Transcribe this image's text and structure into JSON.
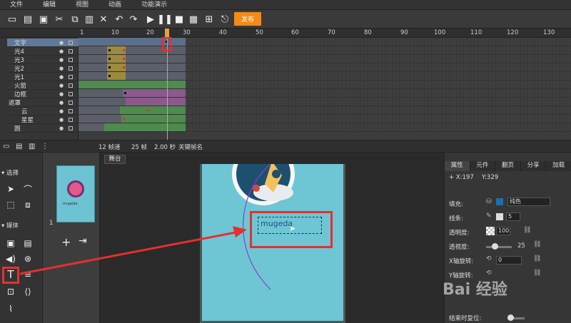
{
  "menu": [
    "文件",
    "编辑",
    "视图",
    "动画",
    "功能演示"
  ],
  "toolbar": {
    "publish_label": "发布"
  },
  "timeline": {
    "ruler": [
      "1",
      "10",
      "20",
      "30",
      "40",
      "50",
      "60",
      "70",
      "80",
      "90",
      "100",
      "110",
      "120",
      "130"
    ],
    "layers": [
      {
        "name": "文字"
      },
      {
        "name": "光4"
      },
      {
        "name": "光3"
      },
      {
        "name": "光2"
      },
      {
        "name": "光1"
      },
      {
        "name": "火箭"
      },
      {
        "name": "边框"
      },
      {
        "name": "遮罩"
      },
      {
        "name": "云"
      },
      {
        "name": "星星"
      },
      {
        "name": "圆"
      }
    ],
    "footer": {
      "fps": "12 帧速",
      "frames": "25 帧",
      "seconds": "2.00 秒",
      "keyframe": "关键帧名"
    }
  },
  "tools": {
    "select_label": "选择",
    "media_label": "媒体"
  },
  "pages": {
    "page_number": "1",
    "thumb_text": "mugeda"
  },
  "stage": {
    "tab_label": "舞台",
    "text_content": "mugeda"
  },
  "props": {
    "tabs": [
      "属性",
      "元件",
      "翻页",
      "分享",
      "加载"
    ],
    "x_label": "X:197",
    "y_label": "Y:329",
    "fill_label": "填充:",
    "fill_mode": "纯色",
    "stroke_label": "线条:",
    "stroke_value": "5",
    "opacity_label": "透明度:",
    "opacity_value": "100",
    "perspective_label": "透视度:",
    "perspective_value": "25",
    "xrot_label": "X轴旋转:",
    "xrot_value": "0",
    "yrot_label": "Y轴旋转:",
    "reset_label": "结束时复位:"
  },
  "watermark": "Bai 经验",
  "colors": {
    "accent": "#f08c1a",
    "highlight": "#e53030",
    "stage": "#6ec6d4"
  }
}
